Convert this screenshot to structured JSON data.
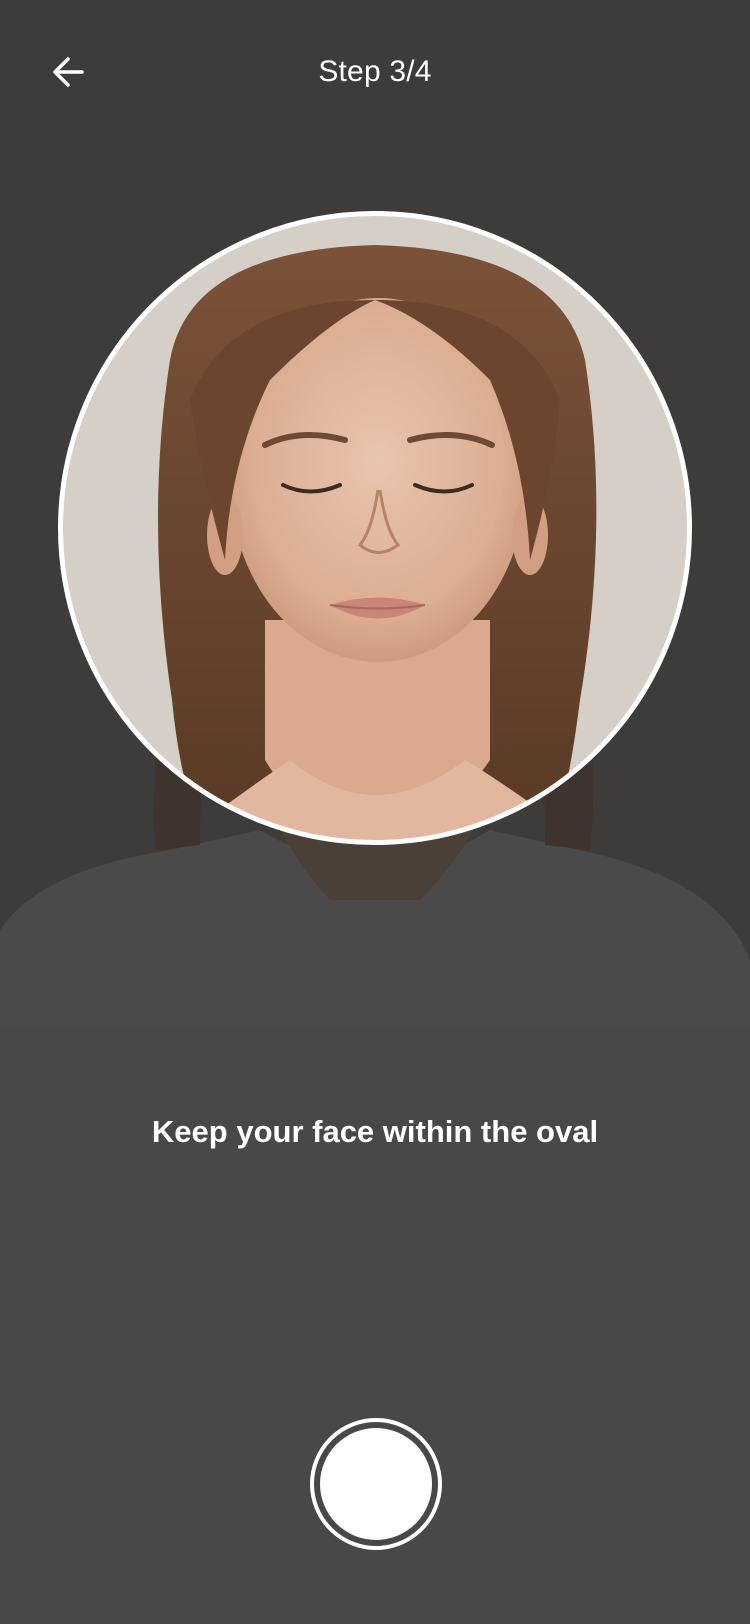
{
  "header": {
    "back_icon": "arrow-left-icon",
    "title": "Step 3/4"
  },
  "camera": {
    "guide_shape": "oval",
    "guide_color": "#ffffff"
  },
  "instruction": "Keep your face within the oval",
  "capture": {
    "icon": "shutter-button",
    "color": "#ffffff"
  },
  "colors": {
    "background": "#484848",
    "text": "#ffffff"
  }
}
